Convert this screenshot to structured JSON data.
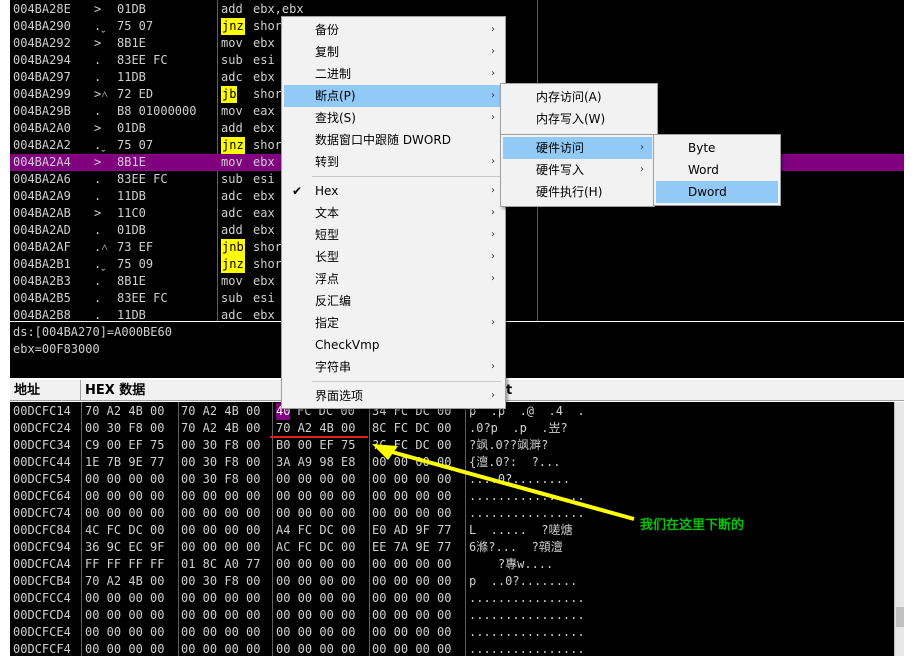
{
  "disasm": {
    "rows": [
      {
        "addr": "004BA28E",
        "jmp": ">",
        "bytes": "01DB",
        "mn": "add",
        "op": "ebx,ebx",
        "j": false
      },
      {
        "addr": "004BA290",
        "jmp": ".ˬ",
        "bytes": "75 07",
        "mn": "jnz",
        "op": "shor",
        "j": true
      },
      {
        "addr": "004BA292",
        "jmp": ">",
        "bytes": "8B1E",
        "mn": "mov",
        "op": "ebx",
        "j": false
      },
      {
        "addr": "004BA294",
        "jmp": ".",
        "bytes": "83EE FC",
        "mn": "sub",
        "op": "esi",
        "j": false
      },
      {
        "addr": "004BA297",
        "jmp": ".",
        "bytes": "11DB",
        "mn": "adc",
        "op": "ebx",
        "j": false
      },
      {
        "addr": "004BA299",
        "jmp": ">˄",
        "bytes": "72 ED",
        "mn": "jb",
        "op": "short",
        "j": true
      },
      {
        "addr": "004BA29B",
        "jmp": ".",
        "bytes": "B8 01000000",
        "mn": "mov",
        "op": "eax",
        "j": false
      },
      {
        "addr": "004BA2A0",
        "jmp": ">",
        "bytes": "01DB",
        "mn": "add",
        "op": "ebx",
        "j": false
      },
      {
        "addr": "004BA2A2",
        "jmp": ".ˬ",
        "bytes": "75 07",
        "mn": "jnz",
        "op": "shor",
        "j": true
      },
      {
        "addr": "004BA2A4",
        "jmp": ">",
        "bytes": "8B1E",
        "mn": "mov",
        "op": "ebx",
        "j": false
      },
      {
        "addr": "004BA2A6",
        "jmp": ".",
        "bytes": "83EE FC",
        "mn": "sub",
        "op": "esi",
        "j": false
      },
      {
        "addr": "004BA2A9",
        "jmp": ".",
        "bytes": "11DB",
        "mn": "adc",
        "op": "ebx",
        "j": false
      },
      {
        "addr": "004BA2AB",
        "jmp": ">",
        "bytes": "11C0",
        "mn": "adc",
        "op": "eax",
        "j": false
      },
      {
        "addr": "004BA2AD",
        "jmp": ".",
        "bytes": "01DB",
        "mn": "add",
        "op": "ebx",
        "j": false
      },
      {
        "addr": "004BA2AF",
        "jmp": ".˄",
        "bytes": "73 EF",
        "mn": "jnb",
        "op": "shor",
        "j": true
      },
      {
        "addr": "004BA2B1",
        "jmp": ".ˬ",
        "bytes": "75 09",
        "mn": "jnz",
        "op": "shor",
        "j": true
      },
      {
        "addr": "004BA2B3",
        "jmp": ".",
        "bytes": "8B1E",
        "mn": "mov",
        "op": "ebx",
        "j": false
      },
      {
        "addr": "004BA2B5",
        "jmp": ".",
        "bytes": "83EE FC",
        "mn": "sub",
        "op": "esi",
        "j": false
      },
      {
        "addr": "004BA2B8",
        "jmp": ".",
        "bytes": "11DB",
        "mn": "adc",
        "op": "ebx",
        "j": false
      }
    ]
  },
  "info": {
    "line1": "ds:[004BA270]=A000BE60",
    "line2": "ebx=00F83000"
  },
  "dump": {
    "col_addr": "地址",
    "col_hex": "HEX 数据",
    "col_ascii": "t",
    "rows": [
      {
        "addr": "00DCFC14",
        "h1": "70 A2 4B 00",
        "h2": "70 A2 4B 00",
        "h3": "40",
        "h3b": "FC DC 00",
        "h4": "34 FC DC 00",
        "asc": "p  .p  .@  .4  ."
      },
      {
        "addr": "00DCFC24",
        "h1": "00 30 F8 00",
        "h2": "70 A2 4B 00",
        "h3": "70 A2 4B 00",
        "h3b": "",
        "h4": "8C FC DC 00",
        "asc": ".0?p  .p  .岦?"
      },
      {
        "addr": "00DCFC34",
        "h1": "C9 00 EF 75",
        "h2": "00 30 F8 00",
        "h3": "B0 00 EF 75",
        "h3b": "",
        "h4": "?C FC DC 00",
        "asc": "?飒.0??飒溿?"
      },
      {
        "addr": "00DCFC44",
        "h1": "1E 7B 9E 77",
        "h2": "00 30 F8 00",
        "h3": "3A A9 98 E8",
        "h3b": "",
        "h4": "00 00 00 00",
        "asc": "{澶.0?:  ?..."
      },
      {
        "addr": "00DCFC54",
        "h1": "00 00 00 00",
        "h2": "00 30 F8 00",
        "h3": "00 00 00 00",
        "h3b": "",
        "h4": "00 00 00 00",
        "asc": "....0?........"
      },
      {
        "addr": "00DCFC64",
        "h1": "00 00 00 00",
        "h2": "00 00 00 00",
        "h3": "00 00 00 00",
        "h3b": "",
        "h4": "00 00 00 00",
        "asc": "................"
      },
      {
        "addr": "00DCFC74",
        "h1": "00 00 00 00",
        "h2": "00 00 00 00",
        "h3": "00 00 00 00",
        "h3b": "",
        "h4": "00 00 00 00",
        "asc": "................"
      },
      {
        "addr": "00DCFC84",
        "h1": "4C FC DC 00",
        "h2": "00 00 00 00",
        "h3": "A4 FC DC 00",
        "h3b": "",
        "h4": "E0 AD 9F 77",
        "asc": "L  .....  ?嗟煻"
      },
      {
        "addr": "00DCFC94",
        "h1": "36 9C EC 9F",
        "h2": "00 00 00 00",
        "h3": "AC FC DC 00",
        "h3b": "",
        "h4": "EE 7A 9E 77",
        "asc": "6滌?...  ?顇澶"
      },
      {
        "addr": "00DCFCA4",
        "h1": "FF FF FF FF",
        "h2": "01 8C A0 77",
        "h3": "00 00 00 00",
        "h3b": "",
        "h4": "00 00 00 00",
        "asc": "    ?專w...."
      },
      {
        "addr": "00DCFCB4",
        "h1": "70 A2 4B 00",
        "h2": "00 30 F8 00",
        "h3": "00 00 00 00",
        "h3b": "",
        "h4": "00 00 00 00",
        "asc": "p  ..0?........"
      },
      {
        "addr": "00DCFCC4",
        "h1": "00 00 00 00",
        "h2": "00 00 00 00",
        "h3": "00 00 00 00",
        "h3b": "",
        "h4": "00 00 00 00",
        "asc": "................"
      },
      {
        "addr": "00DCFCD4",
        "h1": "00 00 00 00",
        "h2": "00 00 00 00",
        "h3": "00 00 00 00",
        "h3b": "",
        "h4": "00 00 00 00",
        "asc": "................"
      },
      {
        "addr": "00DCFCE4",
        "h1": "00 00 00 00",
        "h2": "00 00 00 00",
        "h3": "00 00 00 00",
        "h3b": "",
        "h4": "00 00 00 00",
        "asc": "................"
      },
      {
        "addr": "00DCFCF4",
        "h1": "00 00 00 00",
        "h2": "00 00 00 00",
        "h3": "00 00 00 00",
        "h3b": "",
        "h4": "00 00 00 00",
        "asc": "................"
      }
    ]
  },
  "menu_main": {
    "items": [
      {
        "label": "备份",
        "arrow": true
      },
      {
        "label": "复制",
        "arrow": true
      },
      {
        "label": "二进制",
        "arrow": true
      },
      {
        "label": "断点(P)",
        "arrow": true,
        "active": true
      },
      {
        "label": "查找(S)",
        "arrow": true
      },
      {
        "label": "数据窗口中跟随 DWORD",
        "arrow": false
      },
      {
        "label": "转到",
        "arrow": true
      },
      {
        "label": "Hex",
        "arrow": true,
        "checked": true
      },
      {
        "label": "文本",
        "arrow": true
      },
      {
        "label": "短型",
        "arrow": true
      },
      {
        "label": "长型",
        "arrow": true
      },
      {
        "label": "浮点",
        "arrow": true
      },
      {
        "label": "反汇编",
        "arrow": false
      },
      {
        "label": "指定",
        "arrow": true
      },
      {
        "label": "CheckVmp",
        "arrow": false
      },
      {
        "label": "字符串",
        "arrow": true
      },
      {
        "label": "界面选项",
        "arrow": true
      }
    ]
  },
  "menu_bp": {
    "items": [
      {
        "label": "内存访问(A)",
        "arrow": false
      },
      {
        "label": "内存写入(W)",
        "arrow": false
      },
      {
        "label": "硬件访问",
        "arrow": true,
        "active": true
      },
      {
        "label": "硬件写入",
        "arrow": true
      },
      {
        "label": "硬件执行(H)",
        "arrow": false
      }
    ]
  },
  "menu_hw": {
    "items": [
      {
        "label": "Byte"
      },
      {
        "label": "Word"
      },
      {
        "label": "Dword",
        "active": true
      }
    ]
  },
  "annotation": {
    "text": "我们在这里下断的",
    "color": "#ffff00",
    "underline_color": "#e02020",
    "text_color": "#00c000"
  },
  "icons": {
    "arrow": "›",
    "check": "✔"
  }
}
